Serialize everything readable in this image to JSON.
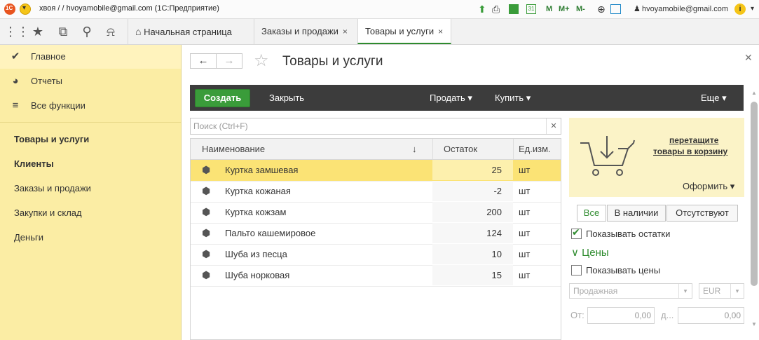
{
  "titlebar": {
    "title": "хвоя / / hvoyamobile@gmail.com  (1С:Предприятие)",
    "toolbar_m": [
      "M",
      "M+",
      "M-"
    ],
    "user": "hvoyamobile@gmail.com"
  },
  "navbar": {
    "tabs": [
      {
        "label": "Начальная страница",
        "closable": false
      },
      {
        "label": "Заказы и продажи",
        "closable": true
      },
      {
        "label": "Товары и услуги",
        "closable": true,
        "active": true
      }
    ],
    "close_glyph": "×"
  },
  "sidebar": {
    "top_items": [
      {
        "label": "Главное",
        "icon": "checkmark-icon"
      },
      {
        "label": "Отчеты",
        "icon": "pie-chart-icon"
      },
      {
        "label": "Все функции",
        "icon": "menu-icon"
      }
    ],
    "sections": [
      "Товары и услуги",
      "Клиенты",
      "Заказы и продажи",
      "Закупки и склад",
      "Деньги"
    ]
  },
  "form": {
    "title": "Товары и услуги",
    "create": "Создать",
    "close": "Закрыть",
    "sell": "Продать ▾",
    "buy": "Купить ▾",
    "more": "Еще ▾",
    "search_placeholder": "Поиск (Ctrl+F)",
    "columns": {
      "name": "Наименование",
      "sort": "↓",
      "qty": "Остаток",
      "unit": "Ед.изм."
    },
    "rows": [
      {
        "name": "Куртка замшевая",
        "qty": "25",
        "unit": "шт",
        "selected": true
      },
      {
        "name": "Куртка кожаная",
        "qty": "-2",
        "unit": "шт"
      },
      {
        "name": "Куртка кожзам",
        "qty": "200",
        "unit": "шт"
      },
      {
        "name": "Пальто кашемировое",
        "qty": "124",
        "unit": "шт"
      },
      {
        "name": "Шуба из песца",
        "qty": "10",
        "unit": "шт"
      },
      {
        "name": "Шуба норковая",
        "qty": "15",
        "unit": "шт"
      }
    ]
  },
  "panel": {
    "cart_line1": "перетащите",
    "cart_line2": "товары в корзину",
    "checkout": "Оформить ▾",
    "filters": [
      "Все",
      "В наличии",
      "Отсутствуют"
    ],
    "show_stock": "Показывать остатки",
    "prices_header": "Цены",
    "show_prices": "Показывать цены",
    "price_type": "Продажная",
    "currency": "EUR",
    "from_label": "От:",
    "from_value": "0,00",
    "to_label": "д...",
    "to_value": "0,00"
  },
  "colors": {
    "accent_green": "#3a9c3a",
    "sidebar_bg": "#fbeda4",
    "selection": "#fbe375",
    "cmdbar": "#3c3c3c"
  }
}
